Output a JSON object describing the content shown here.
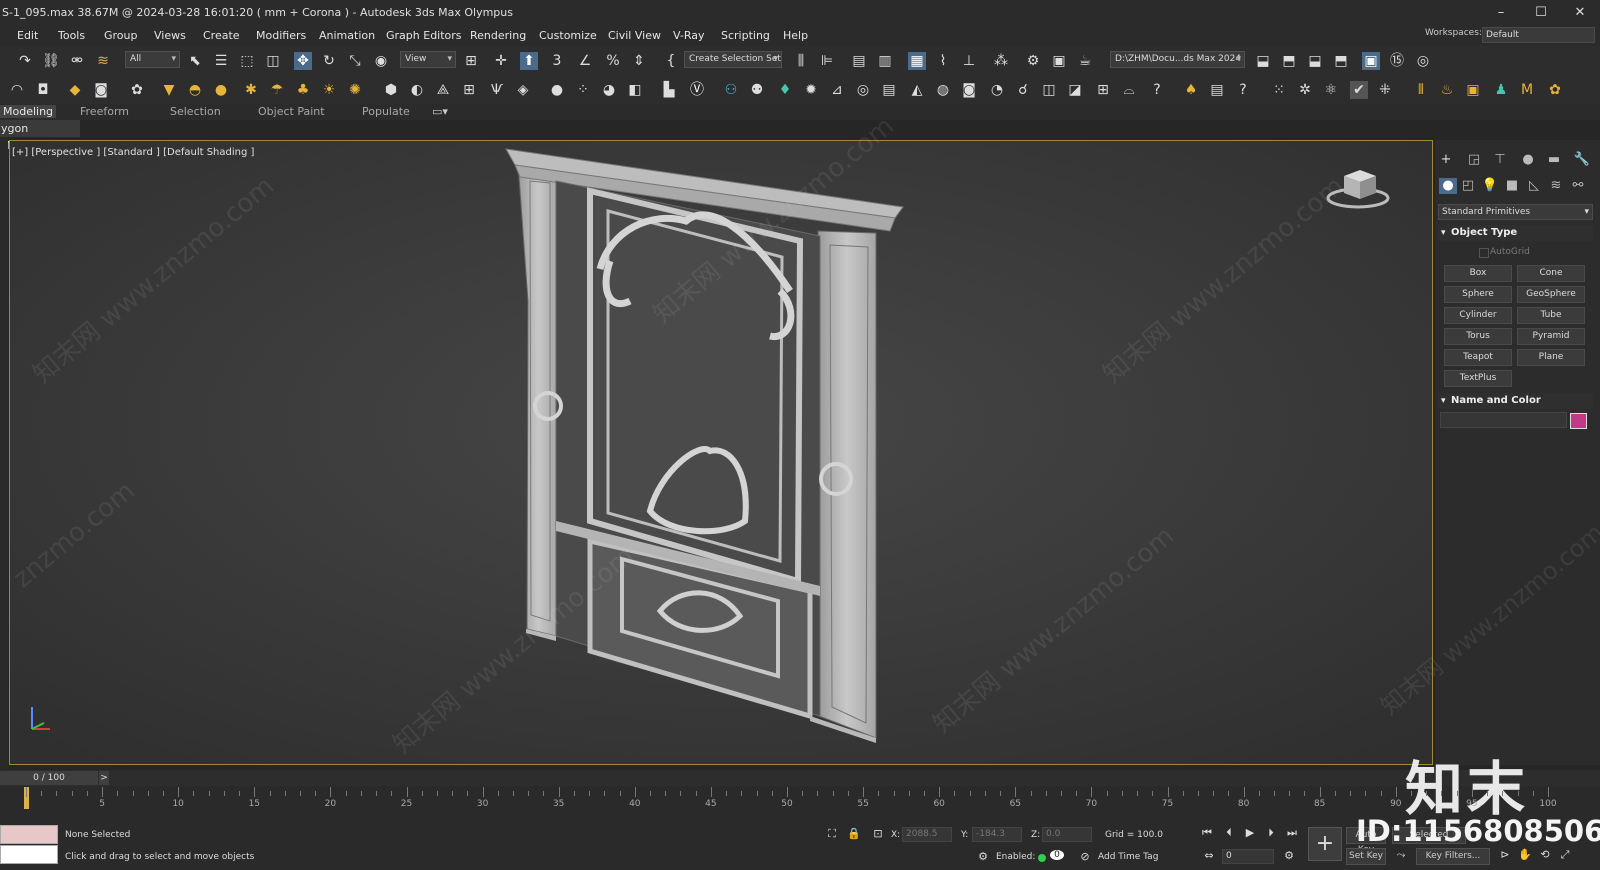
{
  "title": "S-1_095.max  38.67M @ 2024-03-28 16:01:20  ( mm + Corona ) - Autodesk 3ds Max Olympus",
  "window_controls": {
    "minimize": "–",
    "maximize": "☐",
    "close": "✕"
  },
  "menu": [
    "Edit",
    "Tools",
    "Group",
    "Views",
    "Create",
    "Modifiers",
    "Animation",
    "Graph Editors",
    "Rendering",
    "Customize",
    "Civil View",
    "V-Ray",
    "Scripting",
    "Help"
  ],
  "workspace": {
    "label": "Workspaces:",
    "value": "Default"
  },
  "toolbar1": {
    "filter": "All",
    "refcoord": "View",
    "selection_set": "Create Selection Set",
    "project_path": "D:\\ZHM\\Docu...ds Max 2024"
  },
  "ribbon_tabs": [
    "Modeling",
    "Freeform",
    "Selection",
    "Object Paint",
    "Populate"
  ],
  "ribbon_sub": "ygon Modeling",
  "viewport": {
    "label": "[+] [Perspective ] [Standard ] [Default Shading ]"
  },
  "command_panel": {
    "category": "Standard Primitives",
    "object_type_header": "Object Type",
    "autogrid": "AutoGrid",
    "buttons": [
      "Box",
      "Cone",
      "Sphere",
      "GeoSphere",
      "Cylinder",
      "Tube",
      "Torus",
      "Pyramid",
      "Teapot",
      "Plane",
      "TextPlus"
    ],
    "name_color_header": "Name and Color",
    "object_color": "#c03a88"
  },
  "timeline": {
    "position": "0 / 100",
    "next": ">",
    "ticks": [
      "0",
      "5",
      "10",
      "15",
      "20",
      "25",
      "30",
      "35",
      "40",
      "45",
      "50",
      "55",
      "60",
      "65",
      "70",
      "75",
      "80",
      "85",
      "90",
      "95",
      "100"
    ]
  },
  "status": {
    "selection": "None Selected",
    "prompt": "Click and drag to select and move objects",
    "x_label": "X:",
    "x_value": "2088.5",
    "y_label": "Y:",
    "y_value": "-184.3",
    "z_label": "Z:",
    "z_value": "0.0",
    "grid": "Grid = 100.0",
    "enabled": "Enabled:",
    "add_time_tag": "Add Time Tag",
    "autokey": "Auto Key",
    "selected": "Selected",
    "setkey": "Set Key",
    "keyfilters": "Key Filters...",
    "frame": "0"
  },
  "watermark": {
    "text": "知末网 www.znzmo.com",
    "short": "znzmo.com",
    "brand": "知末",
    "id": "ID:1156808506"
  }
}
